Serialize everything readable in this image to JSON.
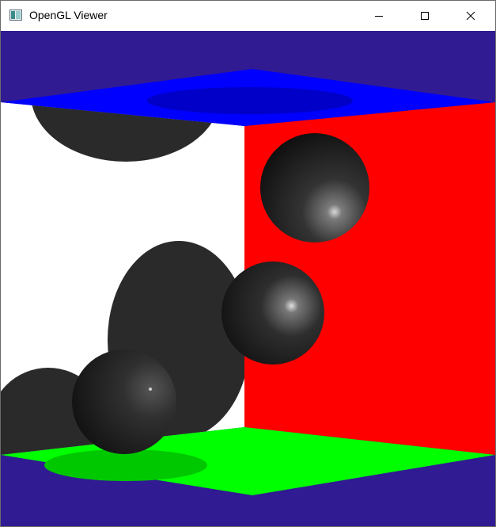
{
  "window": {
    "title": "OpenGL Viewer",
    "icon": "app-window-icon",
    "controls": {
      "minimize": "minimize-icon",
      "maximize": "maximize-icon",
      "close": "close-icon"
    }
  },
  "scene": {
    "background_color": "#311b92",
    "left_wall_color": "#ffffff",
    "right_wall_color": "#ff0000",
    "ceiling_color": "#0000ff",
    "floor_color": "#00ff00",
    "shadow_color": "#2a2a2a",
    "sphere_color": "#1a1a1a",
    "sphere_count": 3
  }
}
